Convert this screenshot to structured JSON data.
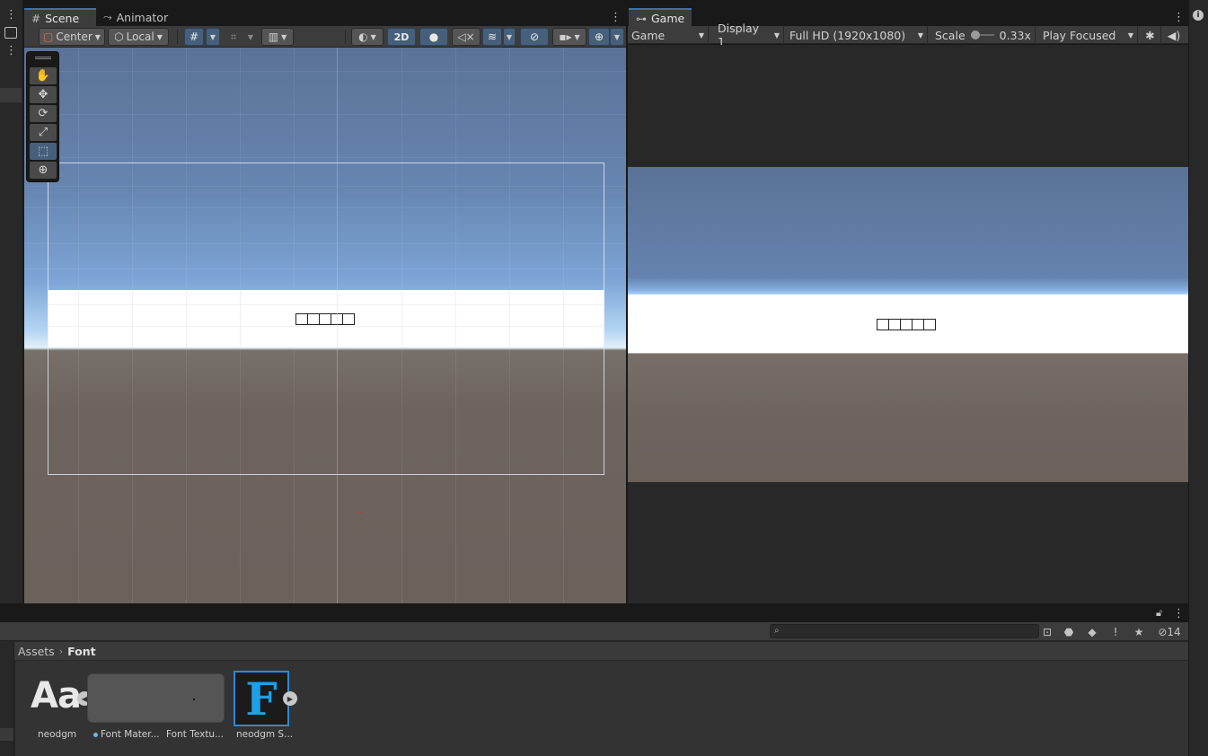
{
  "scene_panel": {
    "tabs": [
      {
        "label": "Scene",
        "icon": "grid-hash-icon",
        "active": true
      },
      {
        "label": "Animator",
        "icon": "animator-icon",
        "active": false
      }
    ],
    "toolbar": {
      "pivot_mode": "Center",
      "pivot_rotation": "Local",
      "mode_2d_label": "2D"
    },
    "tools": [
      "hand-tool",
      "move-tool",
      "rotate-tool",
      "scale-tool",
      "rect-tool",
      "transform-tool"
    ],
    "selected_tool": "rect-tool",
    "canvas_text": [
      "",
      "",
      "",
      "",
      ""
    ]
  },
  "game_panel": {
    "tab_label": "Game",
    "view_dropdown": "Game",
    "display_dropdown": "Display 1",
    "resolution_dropdown": "Full HD (1920x1080)",
    "scale_label": "Scale",
    "scale_value": "0.33x",
    "play_mode_dropdown": "Play Focused"
  },
  "project_panel": {
    "breadcrumb": {
      "root": "Assets",
      "current": "Font"
    },
    "search_placeholder": "",
    "hidden_count": "14",
    "assets": [
      {
        "name": "neodgm",
        "thumb_text": "Aa"
      },
      {
        "name": "Font Mater..."
      },
      {
        "name": "Font Textu..."
      },
      {
        "name": "neodgm S...",
        "thumb_text": "F"
      }
    ]
  },
  "colors": {
    "accent_blue": "#46607c",
    "tab_highlight": "#3a72b0",
    "sdf_icon": "#1da1e6",
    "panel_bg": "#3c3c3c",
    "window_bg": "#191919"
  }
}
